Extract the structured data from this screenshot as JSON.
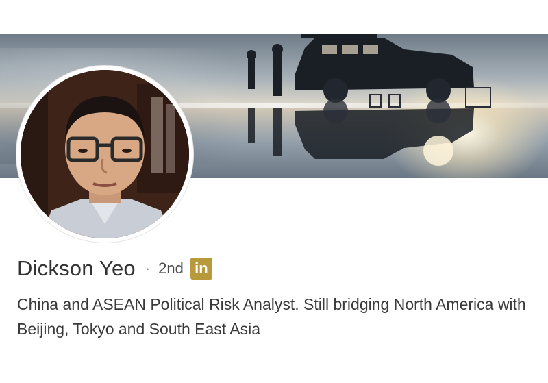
{
  "profile": {
    "name": "Dickson Yeo",
    "separator": "·",
    "connection_degree": "2nd",
    "badge_text": "in",
    "headline": "China and ASEAN Political Risk Analyst. Still bridging North America with Beijing, Tokyo and South East Asia"
  },
  "colors": {
    "badge": "#b89a3c",
    "name": "#333333",
    "headline": "#3a3a3a"
  },
  "icons": {
    "linkedin_badge": "linkedin-icon"
  }
}
